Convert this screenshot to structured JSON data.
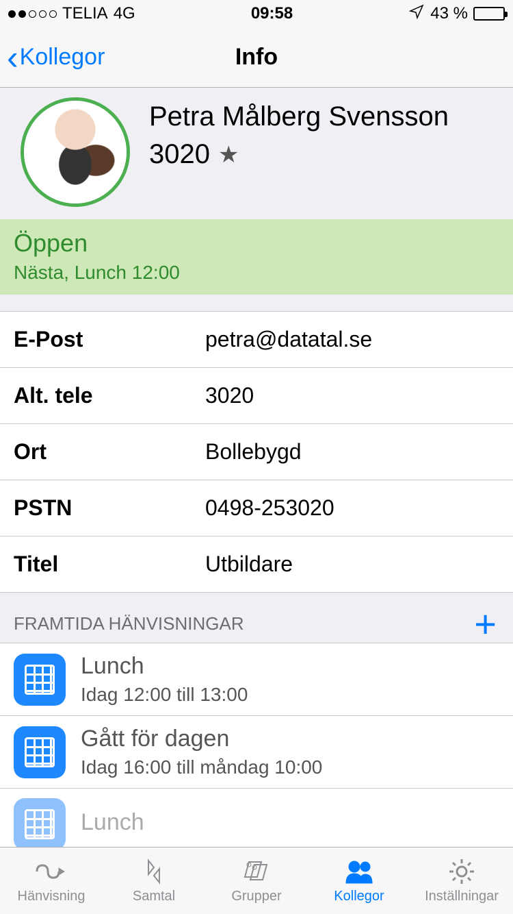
{
  "status_bar": {
    "carrier": "TELIA",
    "network": "4G",
    "time": "09:58",
    "battery_pct": "43 %"
  },
  "nav": {
    "back_label": "Kollegor",
    "title": "Info"
  },
  "profile": {
    "name": "Petra Målberg Svensson",
    "extension": "3020"
  },
  "presence": {
    "status": "Öppen",
    "next": "Nästa, Lunch 12:00"
  },
  "info": [
    {
      "label": "E-Post",
      "value": "petra@datatal.se"
    },
    {
      "label": "Alt. tele",
      "value": "3020"
    },
    {
      "label": "Ort",
      "value": "Bollebygd"
    },
    {
      "label": "PSTN",
      "value": "0498-253020"
    },
    {
      "label": "Titel",
      "value": "Utbildare"
    }
  ],
  "future_section": {
    "title": "FRAMTIDA HÄNVISNINGAR"
  },
  "events": [
    {
      "title": "Lunch",
      "subtitle": "Idag 12:00 till 13:00",
      "faded": false
    },
    {
      "title": "Gått för dagen",
      "subtitle": "Idag 16:00 till måndag 10:00",
      "faded": false
    },
    {
      "title": "Lunch",
      "subtitle": "",
      "faded": true
    }
  ],
  "tabs": [
    {
      "label": "Hänvisning"
    },
    {
      "label": "Samtal"
    },
    {
      "label": "Grupper"
    },
    {
      "label": "Kollegor"
    },
    {
      "label": "Inställningar"
    }
  ]
}
